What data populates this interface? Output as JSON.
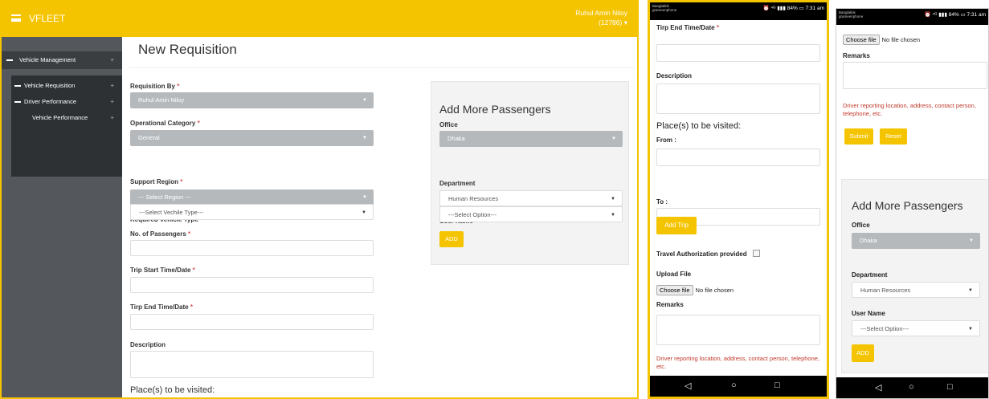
{
  "desktop": {
    "brand": "VFLEET",
    "user_name": "Ruhul Amin Niloy",
    "user_id": "(12786)",
    "user_caret": "▾",
    "sidebar": {
      "top_item": "Vehicle Management",
      "items": [
        {
          "label": "Vehicle Requisition"
        },
        {
          "label": "Driver Performance"
        },
        {
          "label": "Vehicle Performance"
        }
      ],
      "plus": "+"
    },
    "page_title": "New Requisition",
    "form": {
      "requisition_by_label": "Requisition By",
      "requisition_by_value": "Ruhul Amin Niloy",
      "operational_category_label": "Operational Category",
      "operational_category_value": "General",
      "support_region_label": "Support Region",
      "support_region_value": "--- Select Region ---",
      "vehicle_type_label": "Required Vehicle Type",
      "vehicle_type_value": "---Select Vechile Type---",
      "passengers_label": "No. of Passengers",
      "trip_start_label": "Trip Start Time/Date",
      "trip_end_label": "Tirp End Time/Date",
      "description_label": "Description",
      "places_label": "Place(s) to be visited:"
    },
    "add_more": {
      "title": "Add More Passengers",
      "office_label": "Office",
      "office_value": "Dhaka",
      "department_label": "Department",
      "department_value": "Human Resources",
      "username_label": "User Name",
      "username_value": "---Select Option---",
      "add_button": "ADD"
    }
  },
  "phone1": {
    "status_left": "Banglalink\ngrameenphone",
    "status_right": "⏰ ⁴ᴳ ▮▮▮ 84% ▭ 7:31 am",
    "trip_end_label": "Tirp End Time/Date",
    "description_label": "Description",
    "places_label": "Place(s) to be visited:",
    "from_label": "From :",
    "to_label": "To :",
    "add_trip_button": "Add Trip",
    "travel_auth_label": "Travel Authorization provided",
    "upload_label": "Upload File",
    "choose_file": "Choose file",
    "no_file": "No file chosen",
    "remarks_label": "Remarks",
    "hint": "Driver reporting location, address, contact person, telephone, etc."
  },
  "phone2": {
    "status_left": "Banglalink\ngrameenphone",
    "status_right": "⏰ ⁴ᴳ ▮▮▮ 84% ▭ 7:31 am",
    "choose_file": "Choose file",
    "no_file": "No file chosen",
    "remarks_label": "Remarks",
    "hint": "Driver reporting location, address, contact person, telephone, etc.",
    "submit_button": "Submit",
    "reset_button": "Reset",
    "add_more": {
      "title": "Add More Passengers",
      "office_label": "Office",
      "office_value": "Dhaka",
      "department_label": "Department",
      "department_value": "Human Resources",
      "username_label": "User Name",
      "username_value": "---Select Option---",
      "add_button": "ADD"
    }
  },
  "nav": {
    "back": "◁",
    "home": "○",
    "recent": "□"
  },
  "req_mark": "*",
  "caret": "▼"
}
